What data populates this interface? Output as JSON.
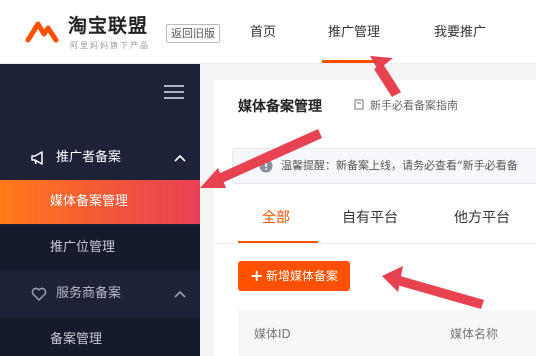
{
  "header": {
    "brand": "淘宝联盟",
    "brand_sub": "阿里妈妈旗下产品",
    "old_version_label": "返回旧版",
    "nav": [
      {
        "label": "首页"
      },
      {
        "label": "推广管理"
      },
      {
        "label": "我要推广"
      }
    ],
    "active_nav": "推广管理"
  },
  "sidebar": {
    "groups": [
      {
        "label": "推广者备案",
        "icon": "megaphone-icon",
        "expanded": true
      },
      {
        "label": "服务商备案",
        "icon": "heart-hand-icon",
        "expanded": true
      }
    ],
    "items": [
      {
        "label": "媒体备案管理",
        "active": true
      },
      {
        "label": "推广位管理",
        "active": false
      },
      {
        "label": "备案管理",
        "active": false
      }
    ]
  },
  "main": {
    "title": "媒体备案管理",
    "guide_link": "新手必看备案指南",
    "notice": "温馨提醒：新备案上线，请务必查看“新手必看备",
    "tabs": [
      {
        "label": "全部",
        "active": true
      },
      {
        "label": "自有平台",
        "active": false
      },
      {
        "label": "他方平台",
        "active": false
      }
    ],
    "add_button": "新增媒体备案",
    "table_headers": [
      "媒体ID",
      "媒体名称"
    ]
  },
  "colors": {
    "accent": "#ff5000",
    "sidebar_bg": "#1e2238",
    "arrow": "#e8414f"
  }
}
